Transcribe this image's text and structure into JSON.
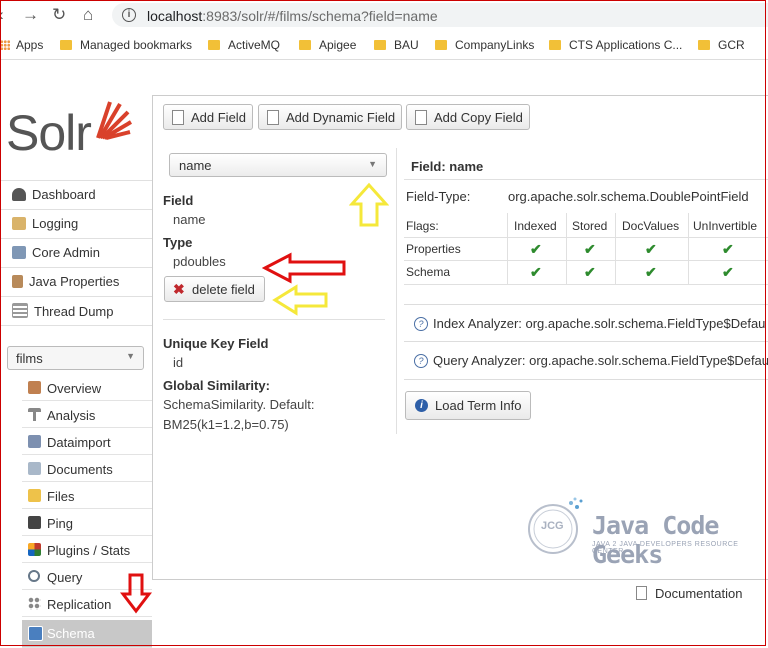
{
  "browser": {
    "url_host": "localhost",
    "url_rest": ":8983/solr/#/films/schema?field=name",
    "bookmarks": [
      "Apps",
      "Managed bookmarks",
      "ActiveMQ",
      "Apigee",
      "BAU",
      "CompanyLinks",
      "CTS Applications C...",
      "GCR"
    ]
  },
  "logo": {
    "text": "Solr"
  },
  "sidebar": {
    "items": [
      {
        "label": "Dashboard",
        "icon": "dashboard-icon",
        "color": "#555555"
      },
      {
        "label": "Logging",
        "icon": "logging-icon",
        "color": "#c8a060"
      },
      {
        "label": "Core Admin",
        "icon": "core-admin-icon",
        "color": "#6688aa"
      },
      {
        "label": "Java Properties",
        "icon": "java-properties-icon",
        "color": "#b07b50"
      },
      {
        "label": "Thread Dump",
        "icon": "thread-dump-icon",
        "color": "#888888"
      }
    ],
    "core_select": "films",
    "core_items": [
      {
        "label": "Overview",
        "icon": "home-icon",
        "color": "#b07040"
      },
      {
        "label": "Analysis",
        "icon": "filter-icon",
        "color": "#777777"
      },
      {
        "label": "Dataimport",
        "icon": "dataimport-icon",
        "color": "#6a7fa0"
      },
      {
        "label": "Documents",
        "icon": "documents-icon",
        "color": "#8899aa"
      },
      {
        "label": "Files",
        "icon": "files-icon",
        "color": "#e0b840"
      },
      {
        "label": "Ping",
        "icon": "ping-icon",
        "color": "#444444"
      },
      {
        "label": "Plugins / Stats",
        "icon": "plugins-icon",
        "color": "#c0392b"
      },
      {
        "label": "Query",
        "icon": "query-icon",
        "color": "#667788"
      },
      {
        "label": "Replication",
        "icon": "replication-icon",
        "color": "#888888"
      },
      {
        "label": "Schema",
        "icon": "schema-icon",
        "color": "#4a7fbf"
      }
    ]
  },
  "toolbar": {
    "add_field": "Add Field",
    "add_dynamic_field": "Add Dynamic Field",
    "add_copy_field": "Add Copy Field"
  },
  "field_select": "name",
  "left_panel": {
    "field_label": "Field",
    "field_value": "name",
    "type_label": "Type",
    "type_value": "pdoubles",
    "delete_label": "delete field",
    "unique_key_label": "Unique Key Field",
    "unique_key_value": "id",
    "similarity_label": "Global Similarity:",
    "similarity_value_1": "SchemaSimilarity. Default:",
    "similarity_value_2": "BM25(k1=1.2,b=0.75)"
  },
  "detail": {
    "title": "Field: name",
    "field_type_label": "Field-Type:",
    "field_type_value": "org.apache.solr.schema.DoublePointField",
    "flags_label": "Flags:",
    "columns": [
      "Indexed",
      "Stored",
      "DocValues",
      "UnInvertible"
    ],
    "rows": [
      "Properties",
      "Schema"
    ],
    "check_glyph": "✔",
    "index_analyzer": "Index Analyzer: org.apache.solr.schema.FieldType$Defau",
    "query_analyzer": "Query Analyzer: org.apache.solr.schema.FieldType$Defau",
    "load_term_info": "Load Term Info"
  },
  "footer": {
    "documentation": "Documentation"
  },
  "watermark": {
    "title": "Java Code Geeks",
    "subtitle": "JAVA 2 JAVA DEVELOPERS RESOURCE CENTER",
    "badge": "JCG"
  },
  "colors": {
    "annotation_red": "#e01010",
    "annotation_yellow": "#f5e83a",
    "check_green": "#2e8b2e",
    "active_item": "#c8c8c8"
  }
}
